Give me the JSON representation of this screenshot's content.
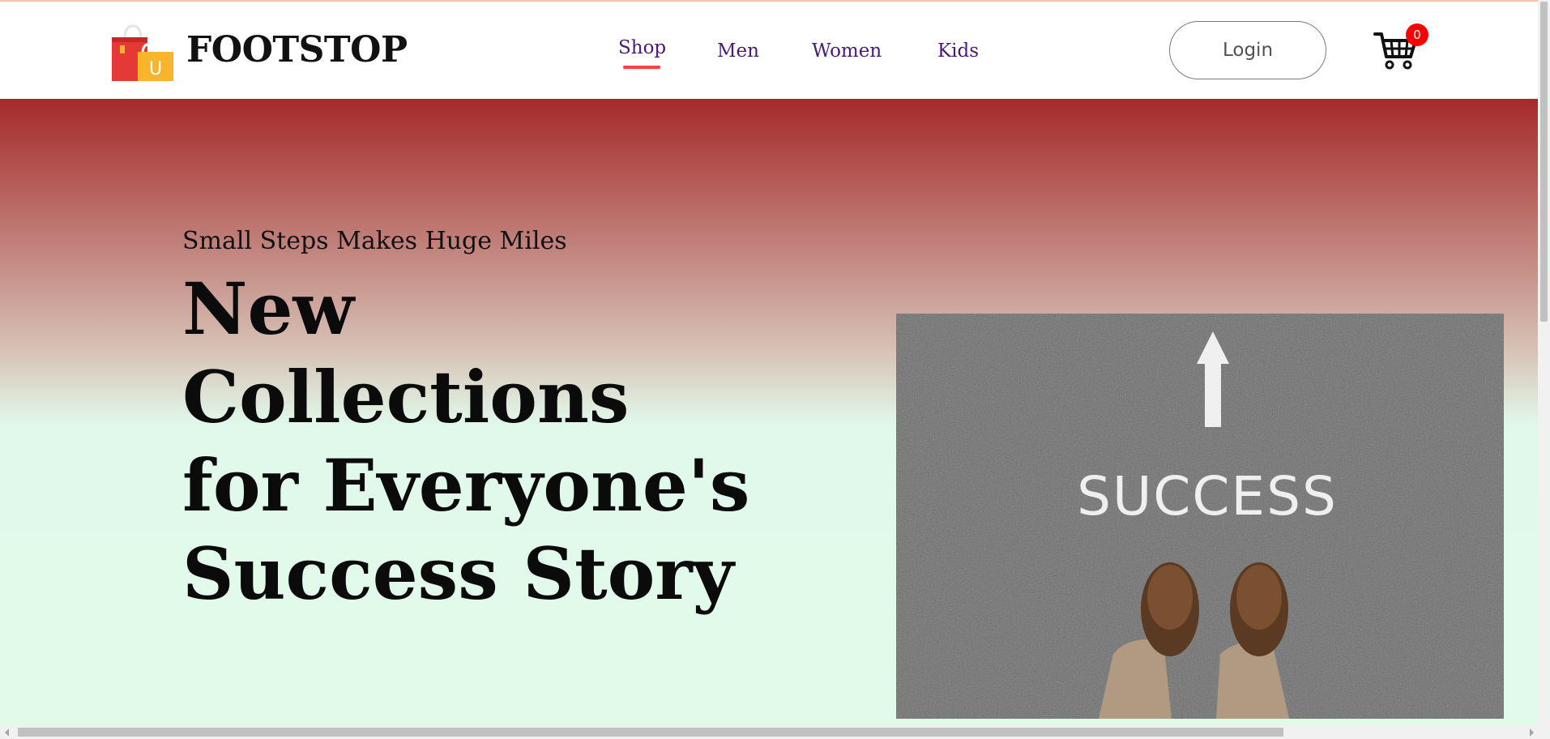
{
  "brand": {
    "name": "FOOTSTOP",
    "logo_icon": "shopping-bag-icon",
    "logo_letter": "U",
    "colors": {
      "bag_red": "#e53935",
      "bag_yellow": "#f7b52c"
    }
  },
  "nav": {
    "items": [
      {
        "label": "Shop",
        "active": true
      },
      {
        "label": "Men",
        "active": false
      },
      {
        "label": "Women",
        "active": false
      },
      {
        "label": "Kids",
        "active": false
      }
    ],
    "link_color": "#4a1a7a",
    "active_underline_color": "#ff4141"
  },
  "header": {
    "login_label": "Login",
    "cart_icon": "cart-icon",
    "cart_count": "0",
    "badge_color": "#ff0000"
  },
  "hero": {
    "subtitle": "Small Steps Makes Huge Miles",
    "title_lines": [
      "New",
      "Collections",
      "for Everyone's",
      "Success Story"
    ],
    "image_text": "SUCCESS",
    "image_icon": "arrow-up-icon",
    "gradient": {
      "top": "#a52a2a",
      "bottom": "#e1faea"
    }
  }
}
